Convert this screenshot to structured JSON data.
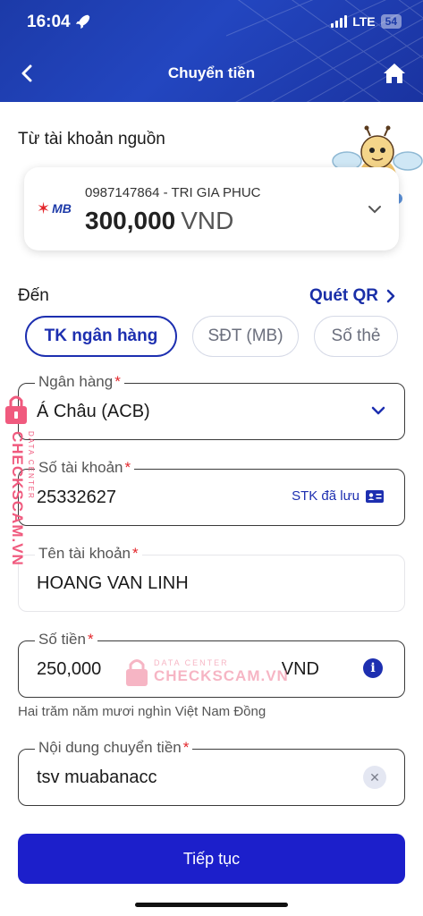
{
  "status_bar": {
    "time": "16:04",
    "network": "LTE",
    "battery": "54"
  },
  "header": {
    "title": "Chuyển tiền"
  },
  "source": {
    "section_label": "Từ tài khoản nguồn",
    "bank_logo": "MB",
    "account_line": "0987147864 - TRI GIA PHUC",
    "balance": "300,000",
    "currency": "VND"
  },
  "destination": {
    "section_label": "Đến",
    "qr_link": "Quét QR",
    "tabs": [
      "TK ngân hàng",
      "SĐT (MB)",
      "Số thẻ"
    ]
  },
  "form": {
    "bank": {
      "label": "Ngân hàng",
      "required": "*",
      "value": "Á Châu (ACB)"
    },
    "account_number": {
      "label": "Số tài khoản",
      "required": "*",
      "value": "25332627",
      "saved_link": "STK đã lưu"
    },
    "account_name": {
      "label": "Tên tài khoản",
      "required": "*",
      "value": "HOANG VAN LINH"
    },
    "amount": {
      "label": "Số tiền",
      "required": "*",
      "value": "250,000",
      "currency": "VND",
      "in_words": "Hai trăm năm mươi nghìn Việt Nam Đồng"
    },
    "content": {
      "label": "Nội dung chuyển tiền",
      "required": "*",
      "value": "tsv muabanacc"
    }
  },
  "actions": {
    "continue": "Tiếp tục"
  },
  "watermark": {
    "brand": "CHECKSCAM.VN",
    "sub": "DATA CENTER"
  },
  "colors": {
    "primary": "#1c1fcb",
    "header": "#2346c0",
    "required": "#e3262b"
  }
}
